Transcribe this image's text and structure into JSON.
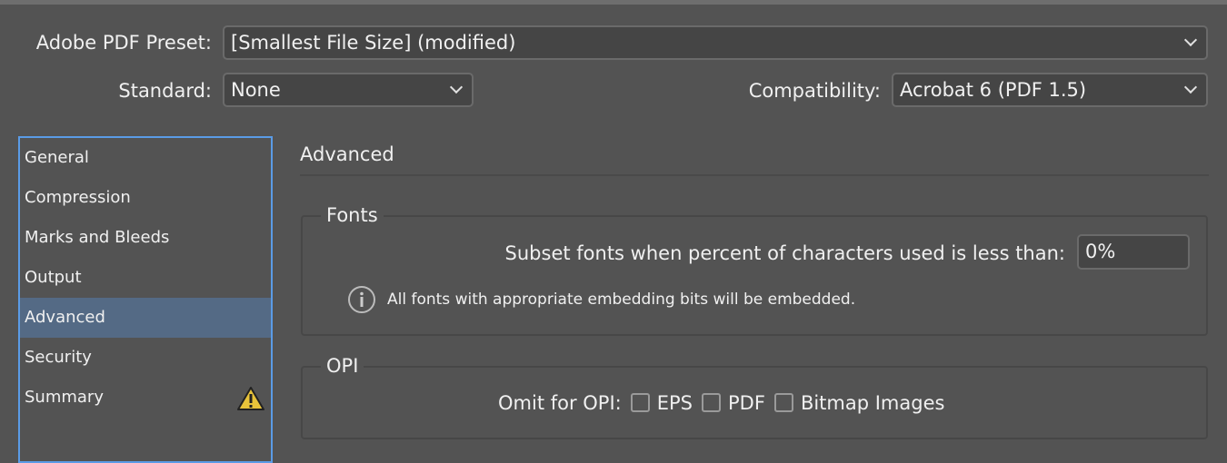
{
  "preset": {
    "label": "Adobe PDF Preset:",
    "value": "[Smallest File Size] (modified)"
  },
  "standard": {
    "label": "Standard:",
    "value": "None"
  },
  "compatibility": {
    "label": "Compatibility:",
    "value": "Acrobat 6 (PDF 1.5)"
  },
  "sidebar": {
    "items": [
      {
        "label": "General"
      },
      {
        "label": "Compression"
      },
      {
        "label": "Marks and Bleeds"
      },
      {
        "label": "Output"
      },
      {
        "label": "Advanced",
        "selected": true
      },
      {
        "label": "Security"
      },
      {
        "label": "Summary",
        "icon": "warning-icon"
      }
    ]
  },
  "panel": {
    "title": "Advanced",
    "fonts": {
      "legend": "Fonts",
      "subset_label": "Subset fonts when percent of characters used is less than:",
      "subset_value": "0%",
      "info": "All fonts with appropriate embedding bits will be embedded."
    },
    "opi": {
      "legend": "OPI",
      "omit_label": "Omit for OPI:",
      "options": [
        {
          "label": "EPS",
          "checked": false
        },
        {
          "label": "PDF",
          "checked": false
        },
        {
          "label": "Bitmap Images",
          "checked": false
        }
      ]
    }
  },
  "colors": {
    "background": "#535353",
    "selection": "#546a85",
    "focus": "#5a9be6",
    "warning": "#e8c33a"
  }
}
